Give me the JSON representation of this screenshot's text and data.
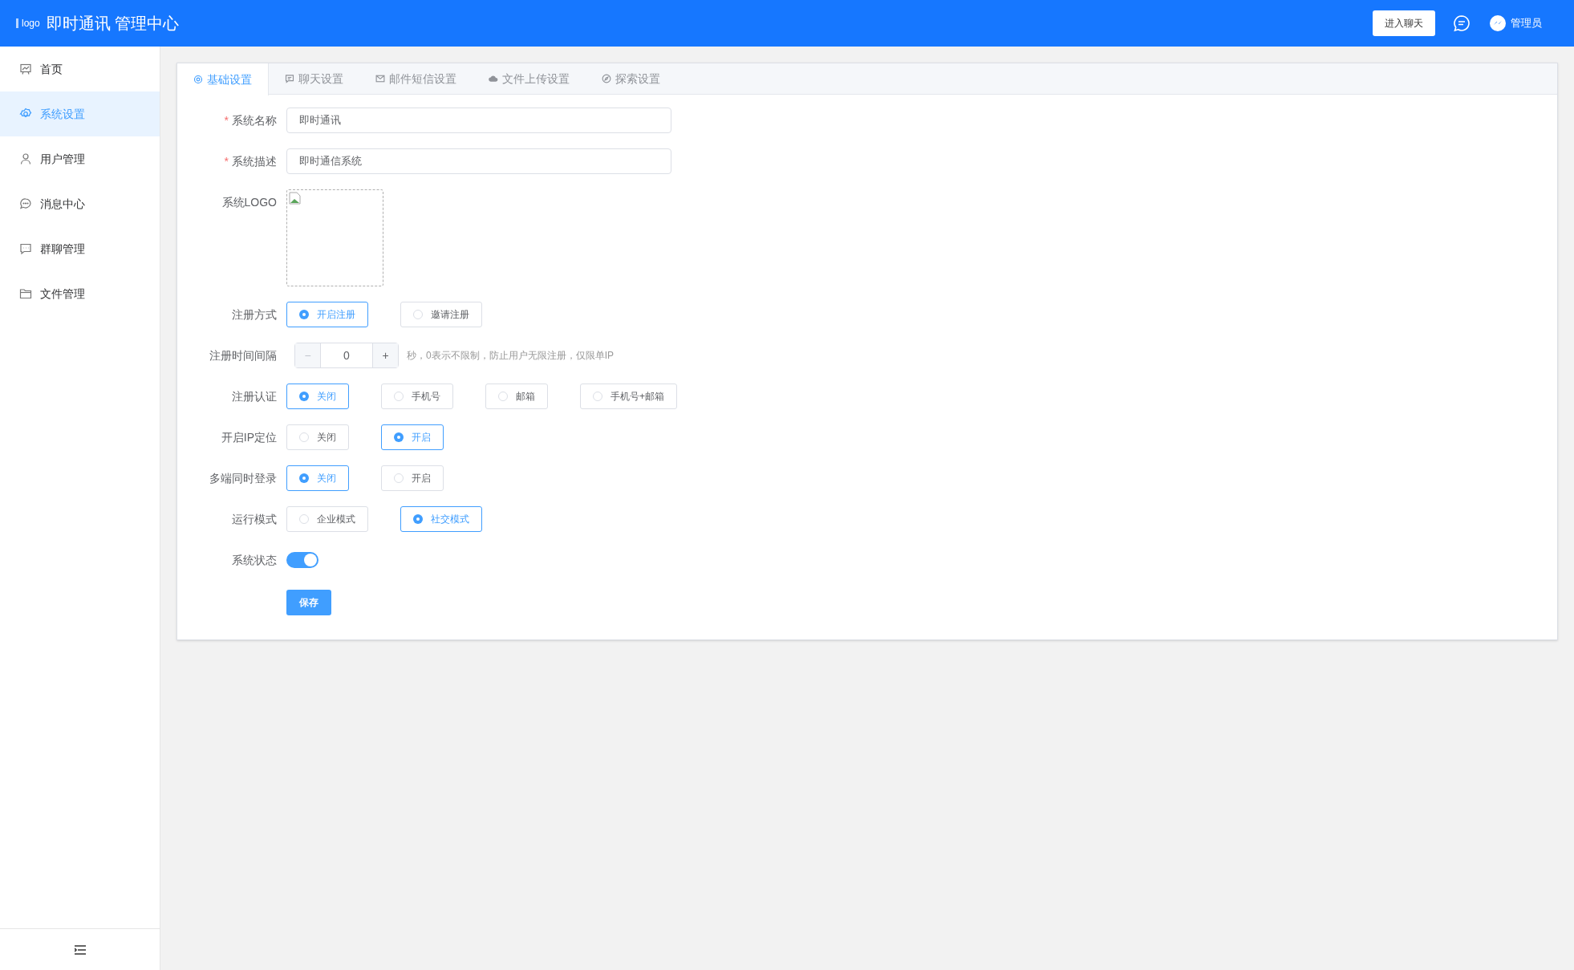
{
  "header": {
    "logo_alt": "logo",
    "title": "即时通讯 管理中心",
    "enter_button": "进入聊天",
    "user": "管理员"
  },
  "sidebar": {
    "items": [
      {
        "label": "首页",
        "selected": false
      },
      {
        "label": "系统设置",
        "selected": true
      },
      {
        "label": "用户管理",
        "selected": false
      },
      {
        "label": "消息中心",
        "selected": false
      },
      {
        "label": "群聊管理",
        "selected": false
      },
      {
        "label": "文件管理",
        "selected": false
      }
    ]
  },
  "tabs": [
    {
      "label": "基础设置",
      "selected": true
    },
    {
      "label": "聊天设置",
      "selected": false
    },
    {
      "label": "邮件短信设置",
      "selected": false
    },
    {
      "label": "文件上传设置",
      "selected": false
    },
    {
      "label": "探索设置",
      "selected": false
    }
  ],
  "form": {
    "fields": [
      {
        "kind": "text",
        "label": "系统名称",
        "required_mark": "*",
        "value": "即时通讯"
      },
      {
        "kind": "text",
        "label": "系统描述",
        "required_mark": "*",
        "value": "即时通信系统"
      },
      {
        "kind": "image",
        "label": "系统LOGO"
      },
      {
        "kind": "radio",
        "label": "注册方式",
        "options": [
          {
            "label": "开启注册",
            "selected": true
          },
          {
            "label": "邀请注册",
            "selected": false
          }
        ]
      },
      {
        "kind": "number",
        "label": "注册时间间隔",
        "value": "0",
        "minus": "−",
        "plus": "+",
        "hint": "秒，0表示不限制，防止用户无限注册，仅限单IP"
      },
      {
        "kind": "radio",
        "label": "注册认证",
        "options": [
          {
            "label": "关闭",
            "selected": true
          },
          {
            "label": "手机号",
            "selected": false
          },
          {
            "label": "邮箱",
            "selected": false
          },
          {
            "label": "手机号+邮箱",
            "selected": false
          }
        ]
      },
      {
        "kind": "radio",
        "label": "开启IP定位",
        "options": [
          {
            "label": "关闭",
            "selected": false
          },
          {
            "label": "开启",
            "selected": true
          }
        ]
      },
      {
        "kind": "radio",
        "label": "多端同时登录",
        "options": [
          {
            "label": "关闭",
            "selected": true
          },
          {
            "label": "开启",
            "selected": false
          }
        ]
      },
      {
        "kind": "radio",
        "label": "运行模式",
        "options": [
          {
            "label": "企业模式",
            "selected": false
          },
          {
            "label": "社交模式",
            "selected": true
          }
        ]
      },
      {
        "kind": "switch",
        "label": "系统状态",
        "on": true
      }
    ],
    "save_button": "保存"
  }
}
